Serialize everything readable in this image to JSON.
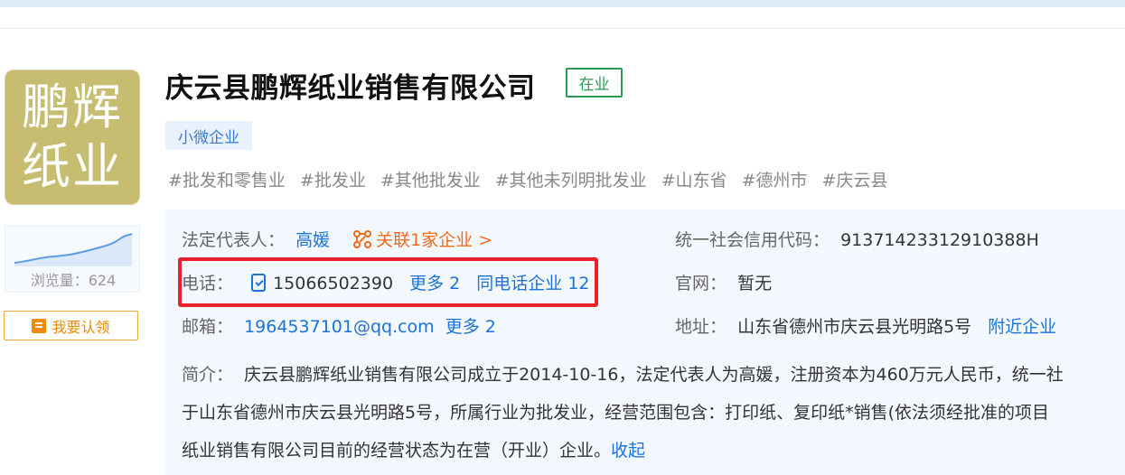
{
  "logo": {
    "line1": "鹏辉",
    "line2": "纸业",
    "bg_color": "#c7bd70"
  },
  "browse": {
    "label": "浏览量：624"
  },
  "claim": {
    "label": "我要认领",
    "icon": "claim-icon"
  },
  "company": {
    "name": "庆云县鹏辉纸业销售有限公司",
    "status": "在业",
    "size_tag": "小微企业",
    "industry_tags": [
      "#批发和零售业",
      "#批发业",
      "#其他批发业",
      "#其他未列明批发业",
      "#山东省",
      "#德州市",
      "#庆云县"
    ]
  },
  "info": {
    "legal_rep_label": "法定代表人：",
    "legal_rep_value": "高媛",
    "related_label": "关联1家企业 >",
    "credit_code_label": "统一社会信用代码：",
    "credit_code_value": "91371423312910388H",
    "phone_label": "电话：",
    "phone_value": "15066502390",
    "phone_more": "更多 2",
    "same_phone": "同电话企业 12",
    "website_label": "官网：",
    "website_value": "暂无",
    "email_label": "邮箱：",
    "email_value": "1964537101@qq.com",
    "email_more": "更多 2",
    "address_label": "地址：",
    "address_value": "山东省德州市庆云县光明路5号",
    "nearby": "附近企业",
    "intro_label": "简介：",
    "intro_line1": "庆云县鹏辉纸业销售有限公司成立于2014-10-16，法定代表人为高媛，注册资本为460万元人民币，统一社",
    "intro_line2": "于山东省德州市庆云县光明路5号，所属行业为批发业，经营范围包含：打印纸、复印纸*销售(依法须经批准的项目",
    "intro_line3": "纸业销售有限公司目前的经营状态为在营（开业）企业。",
    "collapse": "收起"
  },
  "colors": {
    "accent_blue": "#1a73d9",
    "status_green": "#2a9a55",
    "related_orange": "#f06b1b",
    "highlight_red": "#e8212a",
    "claim_orange": "#f08a00"
  }
}
